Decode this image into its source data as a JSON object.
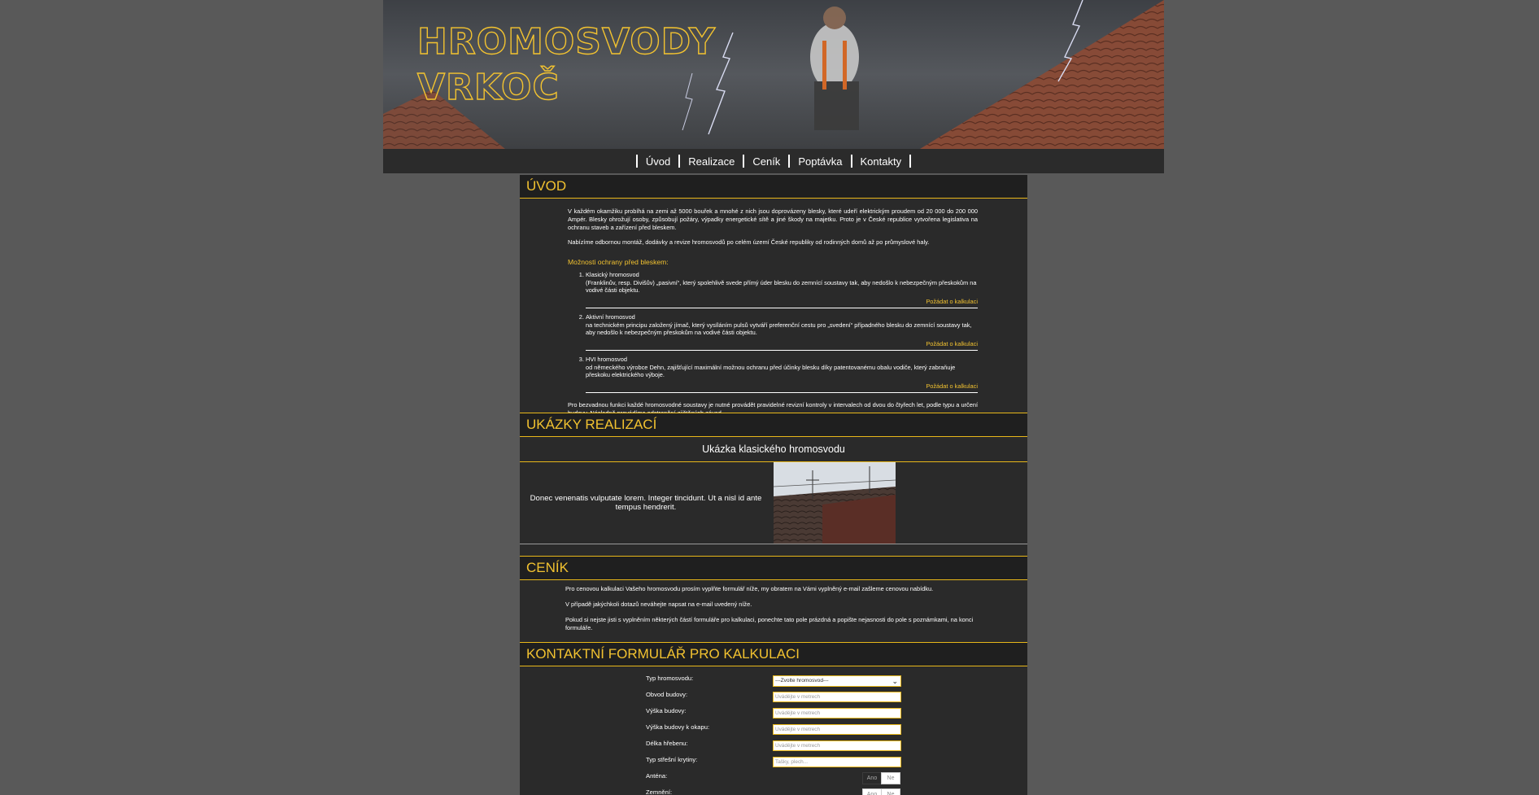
{
  "header": {
    "logo_line1": "HROMOSVODY",
    "logo_line2": "VRKOČ",
    "brand_color": "#f2c230"
  },
  "nav": {
    "items": [
      "Úvod",
      "Realizace",
      "Ceník",
      "Poptávka",
      "Kontakty"
    ]
  },
  "intro": {
    "title": "ÚVOD",
    "p1": "V každém okamžiku probíhá na zemi až 5000 bouřek a mnohé z nich jsou doprovázeny blesky, které udeří elektrickým proudem od 20 000 do 200 000 Ampér. Blesky ohrožují osoby, způsobují požáry, výpadky energetické sítě a jiné škody na majetku. Proto je v České republice vytvořena legislativa na ochranu staveb a zařízení před bleskem.",
    "p2": "Nabízíme odbornou montáž, dodávky a revize hromosvodů po celém území České republiky od rodinných domů až po průmyslové haly.",
    "options_title": "Možnosti ochrany před bleskem:",
    "options": [
      {
        "name": "Klasický hromosvod",
        "desc": "(Franklinův, resp. Divišův) „pasivní“, který spolehlivě svede přímý úder blesku do zemnící soustavy tak, aby nedošlo k nebezpečným přeskokům na vodivé části objektu.",
        "link": "Požádat o kalkulaci"
      },
      {
        "name": "Aktivní hromosvod",
        "desc": "na technickém principu založený jímač, který vysíláním pulsů vytváří preferenční cestu pro „svedení“ případného blesku do zemnící soustavy tak, aby nedošlo k nebezpečným přeskokům na vodivé části objektu.",
        "link": "Požádat o kalkulaci"
      },
      {
        "name": "HVI hromosvod",
        "desc": "od německého výrobce Dehn, zajišťující maximální možnou ochranu před účinky blesku díky patentovanému obalu vodiče, který zabraňuje přeskoku elektrického výboje.",
        "link": "Požádat o kalkulaci"
      }
    ],
    "p3": "Pro bezvadnou funkci každé hromosvodné soustavy je nutné provádět pravidelné revizní kontroly v intervalech od dvou do čtyřech let, podle typu a určení budovy. Následně provádíme odstranění zjištěných závad."
  },
  "realizace": {
    "title": "UKÁZKY REALIZACÍ",
    "caption": "Ukázka klasického hromosvodu",
    "text": "Donec venenatis vulputate lorem. Integer tincidunt. Ut a nisl id ante tempus hendrerit."
  },
  "cenik": {
    "title": "CENÍK",
    "p1": "Pro cenovou kalkulaci Vašeho hromosvodu prosím vyplňte formulář níže, my obratem na Vámi vyplněný e-mail zašleme cenovou nabídku.",
    "p2": "V případě jakýchkoli dotazů neváhejte napsat na e-mail uvedený níže.",
    "p3": "Pokud si nejste jisti s vyplněním některých částí formuláře pro kalkulaci, ponechte tato pole prázdná a popište nejasnosti do pole s poznámkami, na konci formuláře."
  },
  "form": {
    "title": "KONTAKTNÍ FORMULÁŘ PRO KALKULACI",
    "type_label": "Typ hromosvodu:",
    "type_value": "---Zvolte hromosvod---",
    "fields": [
      {
        "label": "Obvod budovy:",
        "placeholder": "Uvádějte v metrech"
      },
      {
        "label": "Výška budovy:",
        "placeholder": "Uvádějte v metrech"
      },
      {
        "label": "Výška budovy k okapu:",
        "placeholder": "Uvádějte v metrech"
      },
      {
        "label": "Délka hřebenu:",
        "placeholder": "Uvádějte v metrech"
      },
      {
        "label": "Typ střešní krytiny:",
        "placeholder": "Tašky, plech..."
      }
    ],
    "antenna_label": "Anténa:",
    "grounding_label": "Zemnění:",
    "yes": "Ano",
    "no": "Ne"
  }
}
